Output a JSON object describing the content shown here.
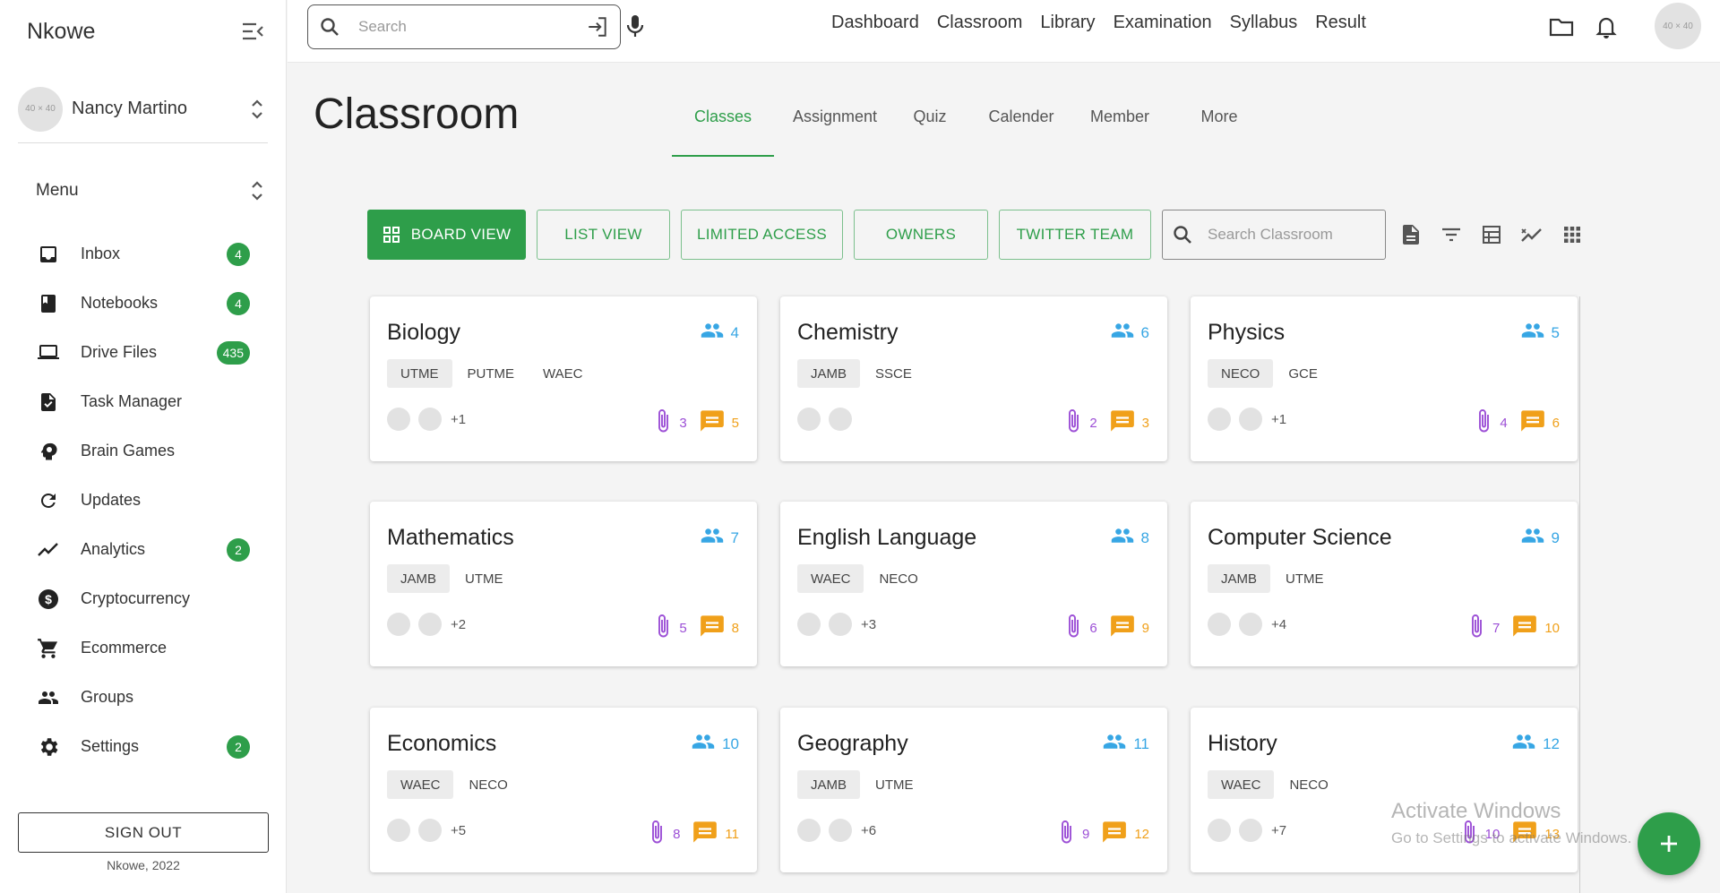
{
  "app": {
    "brand": "Nkowe",
    "copyright": "Nkowe, 2022"
  },
  "user": {
    "name": "Nancy Martino",
    "avatar_text": "40 × 40"
  },
  "menu": {
    "title": "Menu"
  },
  "sidebar": {
    "items": [
      {
        "label": "Inbox",
        "icon": "inbox-icon",
        "badge": "4"
      },
      {
        "label": "Notebooks",
        "icon": "notebook-icon",
        "badge": "4"
      },
      {
        "label": "Drive Files",
        "icon": "laptop-icon",
        "badge": "435"
      },
      {
        "label": "Task Manager",
        "icon": "task-icon",
        "badge": ""
      },
      {
        "label": "Brain Games",
        "icon": "brain-icon",
        "badge": ""
      },
      {
        "label": "Updates",
        "icon": "refresh-icon",
        "badge": ""
      },
      {
        "label": "Analytics",
        "icon": "analytics-icon",
        "badge": "2"
      },
      {
        "label": "Cryptocurrency",
        "icon": "dollar-icon",
        "badge": ""
      },
      {
        "label": "Ecommerce",
        "icon": "cart-icon",
        "badge": ""
      },
      {
        "label": "Groups",
        "icon": "groups-icon",
        "badge": ""
      },
      {
        "label": "Settings",
        "icon": "gear-icon",
        "badge": "2"
      }
    ],
    "signout_label": "SIGN OUT"
  },
  "topbar": {
    "search_placeholder": "Search",
    "nav": [
      "Dashboard",
      "Classroom",
      "Library",
      "Examination",
      "Syllabus",
      "Result"
    ],
    "avatar_text": "40 × 40"
  },
  "page": {
    "title": "Classroom",
    "tabs": [
      "Classes",
      "Assignment",
      "Quiz",
      "Calender",
      "Member",
      "More"
    ],
    "active_tab": "Classes"
  },
  "toolbar": {
    "board_view": "BOARD VIEW",
    "list_view": "LIST VIEW",
    "limited_access": "LIMITED ACCESS",
    "owners": "OWNERS",
    "twitter_team": "TWITTER TEAM",
    "search_placeholder": "Search Classroom"
  },
  "classes": [
    {
      "name": "Biology",
      "members": "4",
      "tags": [
        "UTME",
        "PUTME",
        "WAEC"
      ],
      "extra": "+1",
      "attachments": "3",
      "comments": "5"
    },
    {
      "name": "Chemistry",
      "members": "6",
      "tags": [
        "JAMB",
        "SSCE"
      ],
      "extra": "",
      "attachments": "2",
      "comments": "3"
    },
    {
      "name": "Physics",
      "members": "5",
      "tags": [
        "NECO",
        "GCE"
      ],
      "extra": "+1",
      "attachments": "4",
      "comments": "6"
    },
    {
      "name": "Mathematics",
      "members": "7",
      "tags": [
        "JAMB",
        "UTME"
      ],
      "extra": "+2",
      "attachments": "5",
      "comments": "8"
    },
    {
      "name": "English Language",
      "members": "8",
      "tags": [
        "WAEC",
        "NECO"
      ],
      "extra": "+3",
      "attachments": "6",
      "comments": "9"
    },
    {
      "name": "Computer Science",
      "members": "9",
      "tags": [
        "JAMB",
        "UTME"
      ],
      "extra": "+4",
      "attachments": "7",
      "comments": "10"
    },
    {
      "name": "Economics",
      "members": "10",
      "tags": [
        "WAEC",
        "NECO"
      ],
      "extra": "+5",
      "attachments": "8",
      "comments": "11"
    },
    {
      "name": "Geography",
      "members": "11",
      "tags": [
        "JAMB",
        "UTME"
      ],
      "extra": "+6",
      "attachments": "9",
      "comments": "12"
    },
    {
      "name": "History",
      "members": "12",
      "tags": [
        "WAEC",
        "NECO"
      ],
      "extra": "+7",
      "attachments": "10",
      "comments": "13"
    }
  ],
  "watermark": {
    "line1": "Activate Windows",
    "line2": "Go to Settings to activate Windows."
  },
  "colors": {
    "accent": "#2e9e4a",
    "members": "#37a6e4",
    "attachment": "#9c4fd6",
    "comment": "#f0a01a"
  }
}
